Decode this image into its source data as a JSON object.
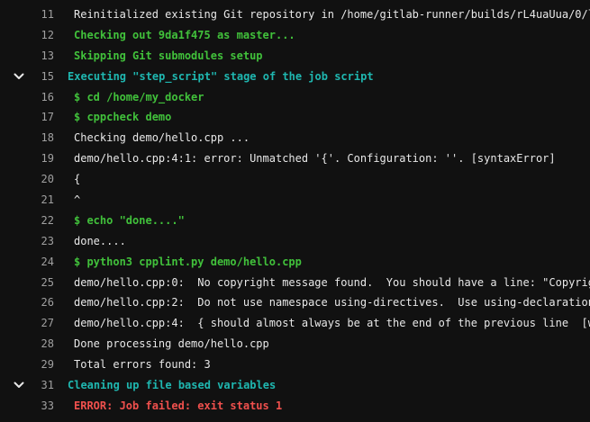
{
  "log": {
    "lines": [
      {
        "n": "11",
        "text": "Reinitialized existing Git repository in /home/gitlab-runner/builds/rL4uaUua/0/l",
        "style": "white"
      },
      {
        "n": "12",
        "text": "Checking out 9da1f475 as master...",
        "style": "green"
      },
      {
        "n": "13",
        "text": "Skipping Git submodules setup",
        "style": "green"
      },
      {
        "n": "15",
        "text": "Executing \"step_script\" stage of the job script",
        "style": "teal",
        "section": true
      },
      {
        "n": "16",
        "text": "$ cd /home/my_docker",
        "style": "green"
      },
      {
        "n": "17",
        "text": "$ cppcheck demo",
        "style": "green"
      },
      {
        "n": "18",
        "text": "Checking demo/hello.cpp ...",
        "style": "white"
      },
      {
        "n": "19",
        "text": "demo/hello.cpp:4:1: error: Unmatched '{'. Configuration: ''. [syntaxError]",
        "style": "white"
      },
      {
        "n": "20",
        "text": "{",
        "style": "white"
      },
      {
        "n": "21",
        "text": "^",
        "style": "white"
      },
      {
        "n": "22",
        "text": "$ echo \"done....\"",
        "style": "green"
      },
      {
        "n": "23",
        "text": "done....",
        "style": "white"
      },
      {
        "n": "24",
        "text": "$ python3 cpplint.py demo/hello.cpp",
        "style": "green"
      },
      {
        "n": "25",
        "text": "demo/hello.cpp:0:  No copyright message found.  You should have a line: \"Copyrig",
        "style": "white"
      },
      {
        "n": "26",
        "text": "demo/hello.cpp:2:  Do not use namespace using-directives.  Use using-declaration",
        "style": "white"
      },
      {
        "n": "27",
        "text": "demo/hello.cpp:4:  { should almost always be at the end of the previous line  [w",
        "style": "white"
      },
      {
        "n": "28",
        "text": "Done processing demo/hello.cpp",
        "style": "white"
      },
      {
        "n": "29",
        "text": "Total errors found: 3",
        "style": "white"
      },
      {
        "n": "31",
        "text": "Cleaning up file based variables",
        "style": "teal",
        "section": true
      },
      {
        "n": "33",
        "text": "ERROR: Job failed: exit status 1",
        "style": "red"
      }
    ]
  },
  "colors": {
    "background": "#111111",
    "line_number": "#a0a0a0",
    "default_text": "#e8e8e8",
    "success_green": "#41c13b",
    "section_teal": "#1fb7b0",
    "error_red": "#f0504d"
  },
  "icons": {
    "section_toggle": "chevron-down-icon"
  }
}
